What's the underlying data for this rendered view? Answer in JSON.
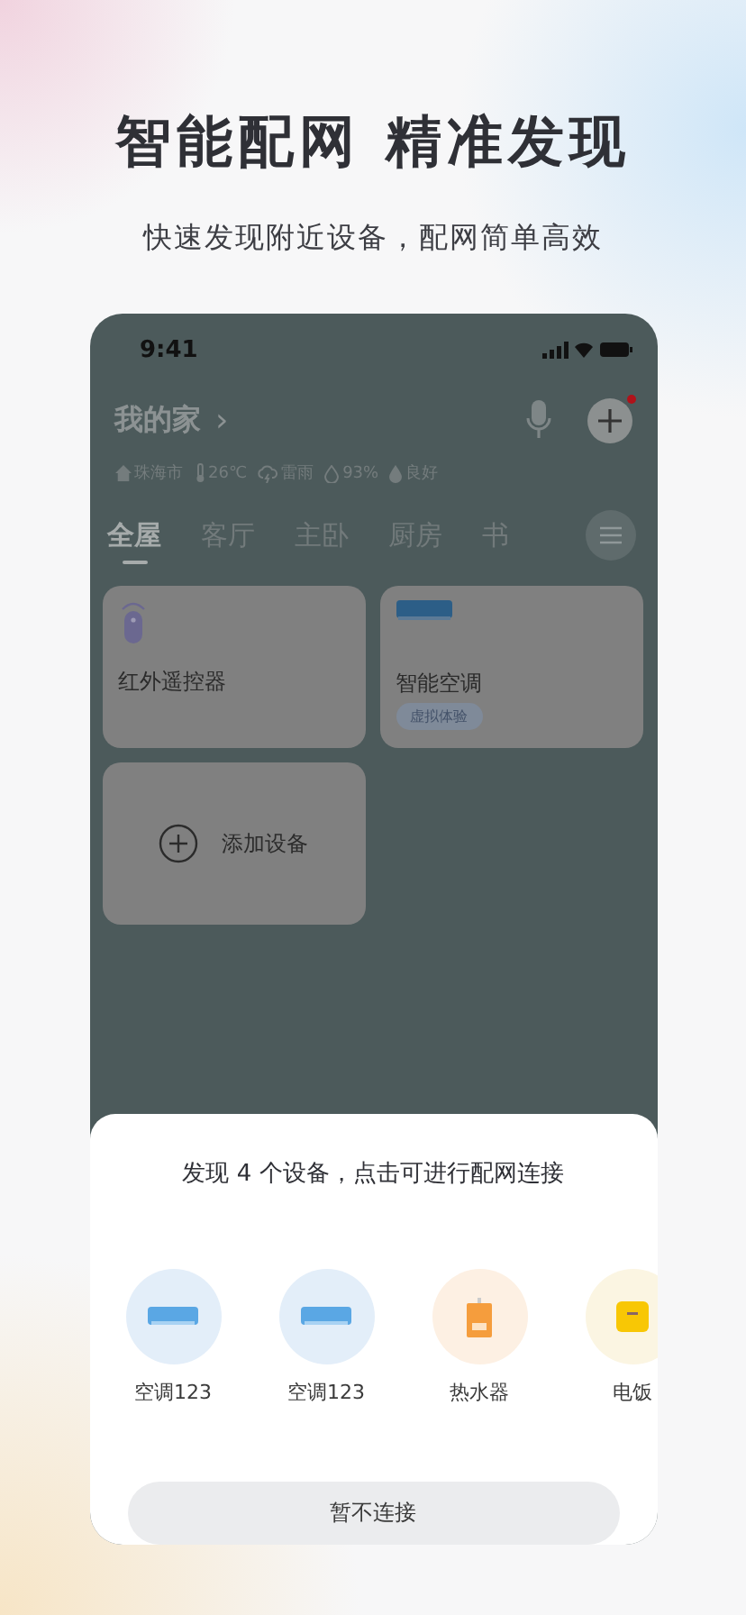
{
  "headline": "智能配网 精准发现",
  "subtitle": "快速发现附近设备，配网简单高效",
  "status_bar": {
    "time": "9:41"
  },
  "home": {
    "title": "我的家",
    "chevron": "›",
    "notification": true
  },
  "weather": [
    {
      "kind": "home",
      "text": "珠海市"
    },
    {
      "kind": "temp",
      "text": "26℃"
    },
    {
      "kind": "cloud",
      "text": "雷雨"
    },
    {
      "kind": "drop",
      "text": "93%"
    },
    {
      "kind": "leaf",
      "text": "良好"
    }
  ],
  "tabs": [
    {
      "label": "全屋",
      "selected": true
    },
    {
      "label": "客厅",
      "selected": false
    },
    {
      "label": "主卧",
      "selected": false
    },
    {
      "label": "厨房",
      "selected": false
    },
    {
      "label": "书",
      "selected": false
    }
  ],
  "cards": [
    {
      "kind": "remote",
      "name": "红外遥控器"
    },
    {
      "kind": "ac",
      "name": "智能空调",
      "badge": "虚拟体验"
    }
  ],
  "add_card": {
    "label": "添加设备"
  },
  "sheet": {
    "message": "发现 4 个设备，点击可进行配网连接",
    "devices": [
      {
        "kind": "ac",
        "name": "空调123"
      },
      {
        "kind": "ac",
        "name": "空调123"
      },
      {
        "kind": "heater",
        "name": "热水器"
      },
      {
        "kind": "cooker",
        "name": "电饭"
      }
    ],
    "button": "暂不连接"
  }
}
